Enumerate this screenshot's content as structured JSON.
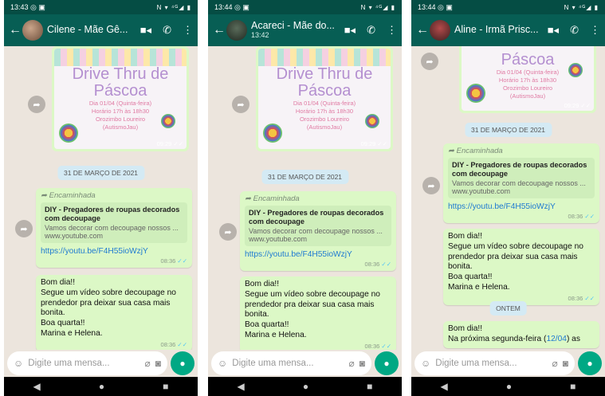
{
  "phones": [
    {
      "status": {
        "time": "13:43",
        "extra": "◎ ▣",
        "right": "N ▾ ⁴ᴳ◢ ▮"
      },
      "contact": {
        "name": "Cilene - Mãe Gê...",
        "subtitle": ""
      },
      "poster": {
        "title1": "Drive Thru de",
        "title2": "Páscoa",
        "line1": "Dia 01/04 (Quinta-feira)",
        "line2": "Horário 17h às 18h30",
        "line3": "Orozimbo Loureiro",
        "line4": "(AutismoJau)",
        "time": "09:29 ✓✓"
      },
      "date1": "31 DE MARÇO DE 2021",
      "fwd_msg": {
        "forwarded": "Encaminhada",
        "preview_title": "DIY - Pregadores de roupas decorados com decoupage",
        "preview_desc": "Vamos decorar com decoupage nossos ...",
        "preview_url": "www.youtube.com",
        "link": "https://youtu.be/F4H55ioWzjY",
        "time": "08:36"
      },
      "text_msg": {
        "lines": [
          "Bom dia!!",
          "Segue um vídeo sobre decoupage no prendedor pra deixar sua casa mais bonita.",
          "Boa quarta!!",
          "Marina e Helena."
        ],
        "time": "08:36"
      },
      "input_placeholder": "Digite uma mensa..."
    },
    {
      "status": {
        "time": "13:44",
        "extra": "◎ ▣",
        "right": "N ▾ ⁴ᴳ◢ ▮"
      },
      "contact": {
        "name": "Acareci - Mãe do...",
        "subtitle": "13:42"
      },
      "poster": {
        "title1": "Drive Thru de",
        "title2": "Páscoa",
        "line1": "Dia 01/04 (Quinta-feira)",
        "line2": "Horário 17h às 18h30",
        "line3": "Orozimbo Loureiro",
        "line4": "(AutismoJau)",
        "time": "09:29 ✓✓"
      },
      "date1": "31 DE MARÇO DE 2021",
      "fwd_msg": {
        "forwarded": "Encaminhada",
        "preview_title": "DIY - Pregadores de roupas decorados com decoupage",
        "preview_desc": "Vamos decorar com decoupage nossos ...",
        "preview_url": "www.youtube.com",
        "link": "https://youtu.be/F4H55ioWzjY",
        "time": "08:36"
      },
      "text_msg": {
        "lines": [
          "Bom dia!!",
          "Segue um vídeo sobre decoupage no prendedor pra deixar sua casa mais bonita.",
          "Boa quarta!!",
          "Marina e Helena."
        ],
        "time": "08:36"
      },
      "input_placeholder": "Digite uma mensa..."
    },
    {
      "status": {
        "time": "13:44",
        "extra": "◎ ▣",
        "right": "N ▾ ⁴ᴳ◢ ▮"
      },
      "contact": {
        "name": "Aline - Irmã Prisc...",
        "subtitle": ""
      },
      "poster": {
        "title1": "",
        "title2": "Páscoa",
        "line1": "Dia 01/04 (Quinta-feira)",
        "line2": "Horário 17h às 18h30",
        "line3": "Orozimbo Loureiro",
        "line4": "(AutismoJau)",
        "time": "09:29 ✓✓"
      },
      "date1": "31 DE MARÇO DE 2021",
      "fwd_msg": {
        "forwarded": "Encaminhada",
        "preview_title": "DIY - Pregadores de roupas decorados com decoupage",
        "preview_desc": "Vamos decorar com decoupage nossos ...",
        "preview_url": "www.youtube.com",
        "link": "https://youtu.be/F4H55ioWzjY",
        "time": "08:36"
      },
      "text_msg": {
        "lines": [
          "Bom dia!!",
          "Segue um vídeo sobre decoupage no prendedor pra deixar sua casa mais bonita.",
          "Boa quarta!!",
          "Marina e Helena."
        ],
        "time": "08:36"
      },
      "date2": "ONTEM",
      "next_msg": {
        "line1": "Bom dia!!",
        "line2_pre": "Na próxima segunda-feira (",
        "line2_link": "12/04",
        "line2_post": ") as"
      },
      "input_placeholder": "Digite uma mensa..."
    }
  ],
  "colors": {
    "header": "#075e54",
    "status": "#054d44",
    "bubble": "#dcf8c6",
    "chat_bg": "#ece5dd",
    "accent": "#00a884",
    "link": "#1f7ad1"
  }
}
